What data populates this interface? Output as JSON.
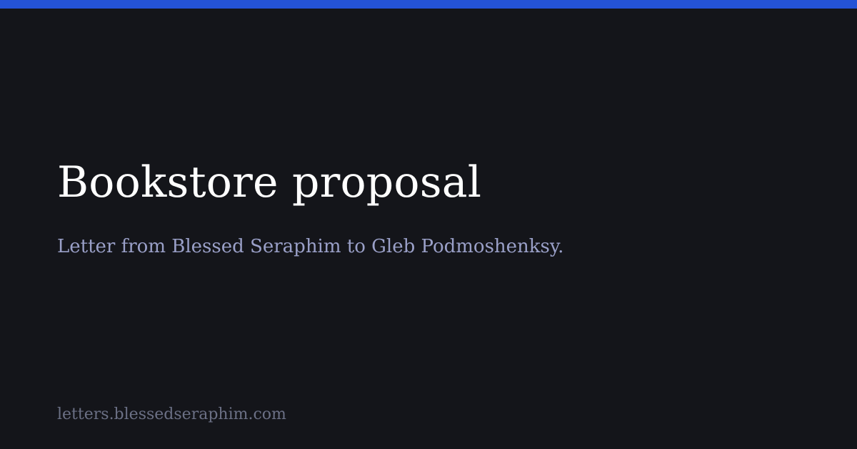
{
  "title": "Bookstore proposal",
  "subtitle": "Letter from Blessed Seraphim to Gleb Podmoshenksy.",
  "site_url": "letters.blessedseraphim.com",
  "colors": {
    "background": "#14151a",
    "accent_bar": "#2453d6",
    "title": "#ffffff",
    "subtitle": "#9aa0c8",
    "url": "#6b7085"
  }
}
